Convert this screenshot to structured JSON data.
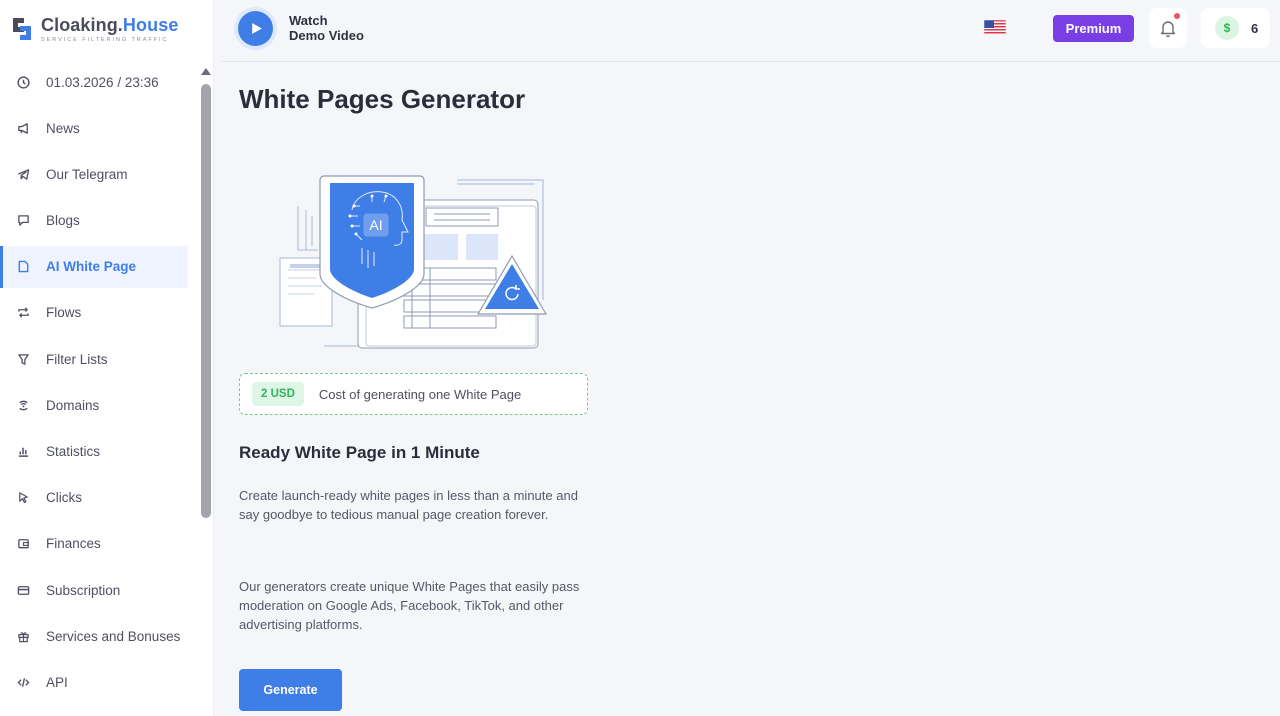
{
  "brand": {
    "name_main": "Cloaking.",
    "name_accent": "House",
    "tagline": "Service filtering traffic"
  },
  "sidebar": {
    "items": [
      {
        "label": "01.03.2026 / 23:36",
        "icon": "clock-icon",
        "active": false
      },
      {
        "label": "News",
        "icon": "megaphone-icon",
        "active": false
      },
      {
        "label": "Our Telegram",
        "icon": "telegram-icon",
        "active": false
      },
      {
        "label": "Blogs",
        "icon": "chat-icon",
        "active": false
      },
      {
        "label": "AI White Page",
        "icon": "page-icon",
        "active": true
      },
      {
        "label": "Flows",
        "icon": "repeat-icon",
        "active": false
      },
      {
        "label": "Filter Lists",
        "icon": "filter-icon",
        "active": false
      },
      {
        "label": "Domains",
        "icon": "domains-icon",
        "active": false
      },
      {
        "label": "Statistics",
        "icon": "bar-chart-icon",
        "active": false
      },
      {
        "label": "Clicks",
        "icon": "cursor-icon",
        "active": false
      },
      {
        "label": "Finances",
        "icon": "wallet-icon",
        "active": false
      },
      {
        "label": "Subscription",
        "icon": "card-icon",
        "active": false
      },
      {
        "label": "Services and Bonuses",
        "icon": "gift-icon",
        "active": false
      },
      {
        "label": "API",
        "icon": "code-icon",
        "active": false
      }
    ]
  },
  "header": {
    "watch_line1": "Watch",
    "watch_line2": "Demo Video",
    "premium_label": "Premium",
    "currency_symbol": "$",
    "balance": "6"
  },
  "main": {
    "title": "White Pages Generator",
    "illustration_label": "AI",
    "cost_badge": "2 USD",
    "cost_text": "Cost of generating one White Page",
    "subheading": "Ready White Page in 1 Minute",
    "paragraph1": "Create launch-ready white pages in less than a minute and say goodbye to tedious manual page creation forever.",
    "paragraph2": "Our generators create unique White Pages that easily pass moderation on Google Ads, Facebook, TikTok, and other advertising platforms.",
    "generate_label": "Generate"
  },
  "colors": {
    "accent": "#3e7ee6",
    "premium": "#7a3fe4",
    "success": "#2fb45a",
    "notification": "#f0506e"
  }
}
